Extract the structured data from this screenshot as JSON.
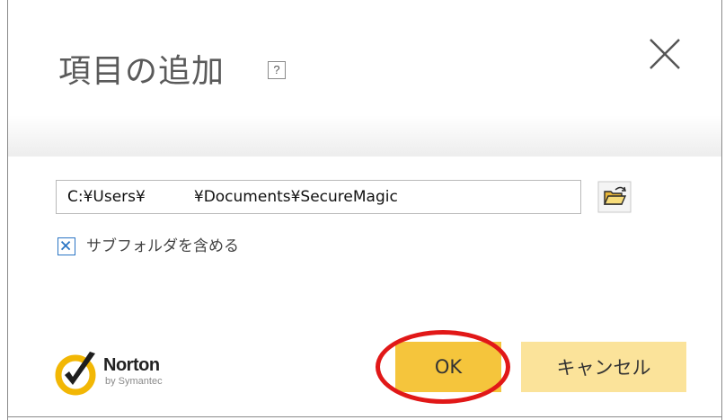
{
  "dialog": {
    "title": "項目の追加",
    "help_label": "?",
    "close_icon": "close-icon"
  },
  "folder": {
    "path_value": "C:¥Users¥          ¥Documents¥SecureMagic",
    "browse_icon": "folder-open-icon"
  },
  "include_subfolders": {
    "label": "サブフォルダを含める",
    "checked": true
  },
  "logo": {
    "name": "Norton",
    "sub": "by Symantec"
  },
  "buttons": {
    "ok_label": "OK",
    "cancel_label": "キャンセル"
  },
  "colors": {
    "ok": "#f5c53c",
    "cancel": "#fbe39a",
    "check": "#2b75c4",
    "highlight": "#e11818"
  }
}
